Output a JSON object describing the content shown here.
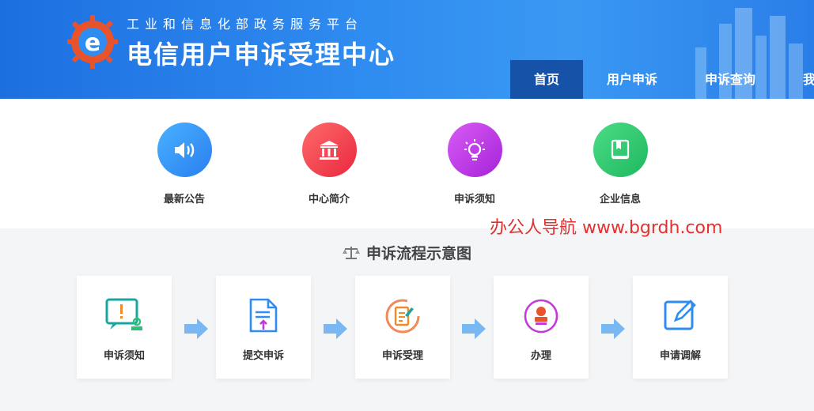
{
  "header": {
    "subtitle": "工业和信息化部政务服务平台",
    "title": "电信用户申诉受理中心"
  },
  "nav": [
    {
      "label": "首页",
      "active": true
    },
    {
      "label": "用户申诉",
      "active": false
    },
    {
      "label": "申诉查询",
      "active": false
    },
    {
      "label": "我",
      "active": false
    }
  ],
  "quick_links": [
    {
      "label": "最新公告",
      "icon": "speaker-icon",
      "color": "#2f8cf0"
    },
    {
      "label": "中心简介",
      "icon": "building-icon",
      "color": "#ef3a4f"
    },
    {
      "label": "申诉须知",
      "icon": "lightbulb-icon",
      "color": "#b62ee0"
    },
    {
      "label": "企业信息",
      "icon": "book-icon",
      "color": "#27c56b"
    }
  ],
  "watermark": "办公人导航 www.bgrdh.com",
  "process": {
    "title": "申诉流程示意图",
    "steps": [
      {
        "label": "申诉须知",
        "icon": "notice-icon"
      },
      {
        "label": "提交申诉",
        "icon": "submit-document-icon"
      },
      {
        "label": "申诉受理",
        "icon": "accept-icon"
      },
      {
        "label": "办理",
        "icon": "stamp-icon"
      },
      {
        "label": "申请调解",
        "icon": "edit-icon"
      }
    ]
  }
}
